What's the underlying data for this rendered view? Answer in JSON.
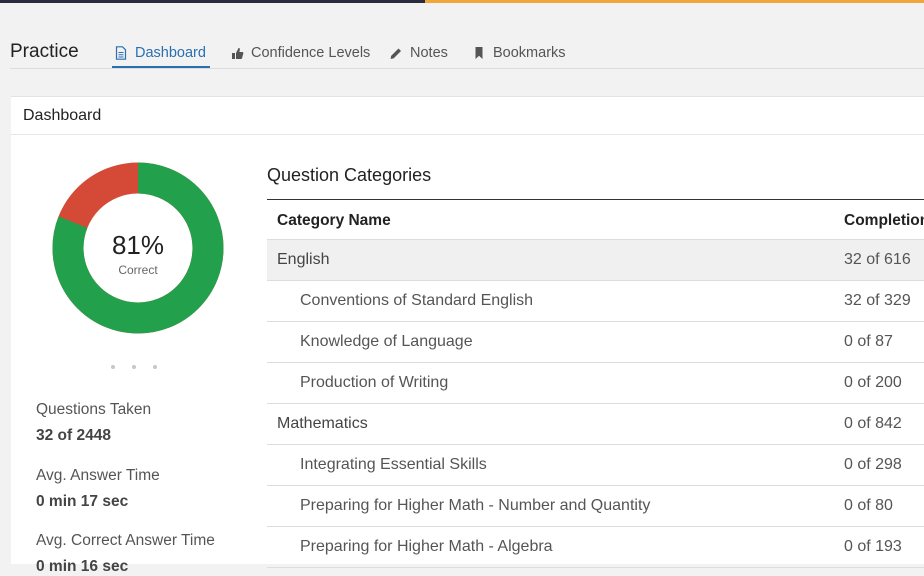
{
  "header": {
    "title": "Practice",
    "tabs": [
      {
        "label": "Dashboard",
        "icon": "document-icon",
        "active": true
      },
      {
        "label": "Confidence Levels",
        "icon": "thumbs-up-icon",
        "active": false
      },
      {
        "label": "Notes",
        "icon": "pencil-icon",
        "active": false
      },
      {
        "label": "Bookmarks",
        "icon": "bookmark-icon",
        "active": false
      }
    ]
  },
  "panel": {
    "title": "Dashboard"
  },
  "summary": {
    "percent_label": "81%",
    "percent_sub": "Correct",
    "correct_fraction": 0.81,
    "colors": {
      "correct": "#23a04b",
      "incorrect": "#d44a36"
    },
    "stats": [
      {
        "label": "Questions Taken",
        "value": "32 of 2448"
      },
      {
        "label": "Avg. Answer Time",
        "value": "0 min 17 sec"
      },
      {
        "label": "Avg. Correct Answer Time",
        "value": "0 min 16 sec"
      }
    ]
  },
  "categories": {
    "title": "Question Categories",
    "col_name": "Category Name",
    "col_completion": "Completion",
    "rows": [
      {
        "name": "English",
        "completion": "32 of 616",
        "level": "category"
      },
      {
        "name": "Conventions of Standard English",
        "completion": "32 of 329",
        "level": "sub"
      },
      {
        "name": "Knowledge of Language",
        "completion": "0 of 87",
        "level": "sub"
      },
      {
        "name": "Production of Writing",
        "completion": "0 of 200",
        "level": "sub"
      },
      {
        "name": "Mathematics",
        "completion": "0 of 842",
        "level": "category"
      },
      {
        "name": "Integrating Essential Skills",
        "completion": "0 of 298",
        "level": "sub"
      },
      {
        "name": "Preparing for Higher Math - Number and Quantity",
        "completion": "0 of 80",
        "level": "sub"
      },
      {
        "name": "Preparing for Higher Math - Algebra",
        "completion": "0 of 193",
        "level": "sub"
      }
    ]
  }
}
